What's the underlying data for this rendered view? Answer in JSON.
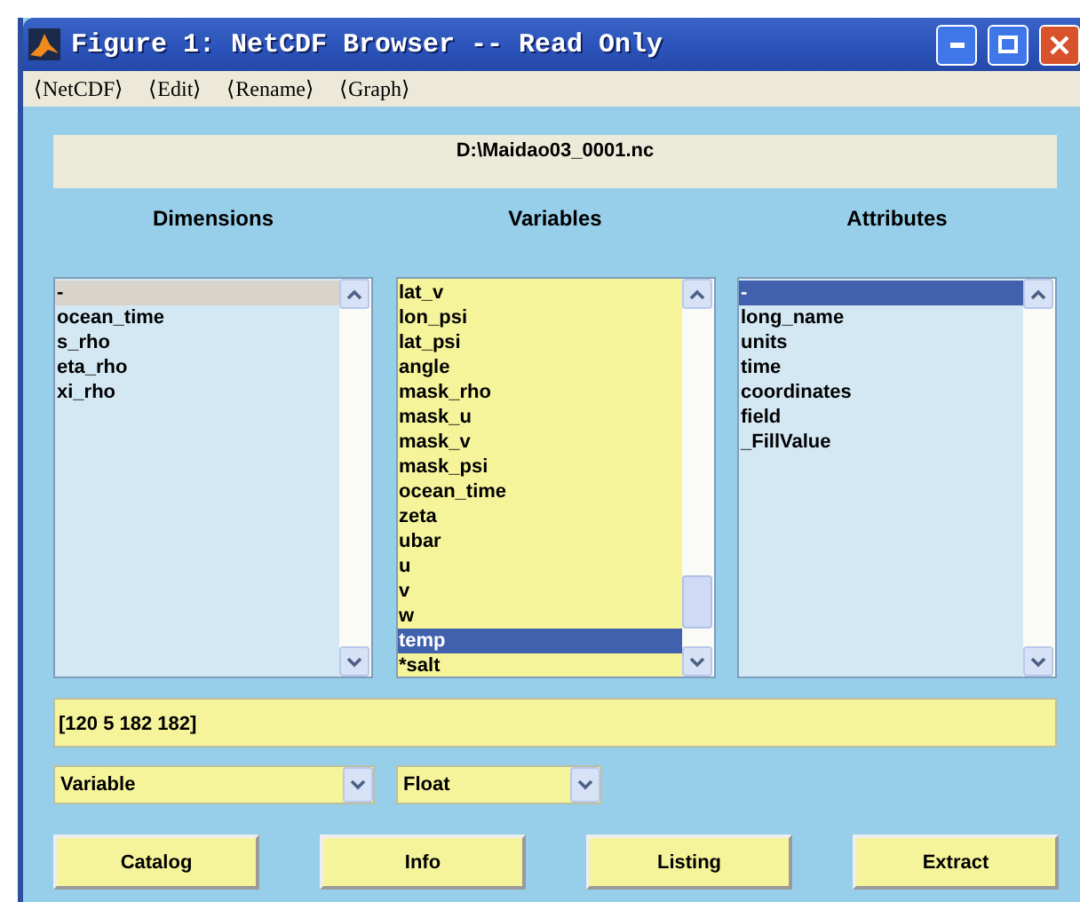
{
  "window": {
    "title": "Figure 1: NetCDF Browser -- Read Only"
  },
  "menu": [
    {
      "label": "⟨NetCDF⟩"
    },
    {
      "label": "⟨Edit⟩"
    },
    {
      "label": "⟨Rename⟩"
    },
    {
      "label": "⟨Graph⟩"
    }
  ],
  "file_path": "D:\\Maidao03_0001.nc",
  "lists": [
    {
      "heading": "Dimensions",
      "focused": false,
      "items": [
        {
          "label": "-",
          "selected": true
        },
        {
          "label": "ocean_time",
          "selected": false
        },
        {
          "label": "s_rho",
          "selected": false
        },
        {
          "label": "eta_rho",
          "selected": false
        },
        {
          "label": "xi_rho",
          "selected": false
        }
      ]
    },
    {
      "heading": "Variables",
      "focused": true,
      "items": [
        {
          "label": "lat_v",
          "selected": false
        },
        {
          "label": "lon_psi",
          "selected": false
        },
        {
          "label": "lat_psi",
          "selected": false
        },
        {
          "label": "angle",
          "selected": false
        },
        {
          "label": "mask_rho",
          "selected": false
        },
        {
          "label": "mask_u",
          "selected": false
        },
        {
          "label": "mask_v",
          "selected": false
        },
        {
          "label": "mask_psi",
          "selected": false
        },
        {
          "label": "ocean_time",
          "selected": false
        },
        {
          "label": "zeta",
          "selected": false
        },
        {
          "label": "ubar",
          "selected": false
        },
        {
          "label": "u",
          "selected": false
        },
        {
          "label": "v",
          "selected": false
        },
        {
          "label": "w",
          "selected": false
        },
        {
          "label": "temp",
          "selected": true
        },
        {
          "label": "*salt",
          "selected": false
        }
      ]
    },
    {
      "heading": "Attributes",
      "focused": true,
      "items": [
        {
          "label": "-",
          "selected": true
        },
        {
          "label": "long_name",
          "selected": false
        },
        {
          "label": "units",
          "selected": false
        },
        {
          "label": "time",
          "selected": false
        },
        {
          "label": "coordinates",
          "selected": false
        },
        {
          "label": "field",
          "selected": false
        },
        {
          "label": "_FillValue",
          "selected": false
        }
      ]
    }
  ],
  "shape_field": {
    "value": "[120 5 182 182]"
  },
  "dropdowns": [
    {
      "value": "Variable"
    },
    {
      "value": "Float"
    }
  ],
  "buttons": [
    "Catalog",
    "Info",
    "Listing",
    "Extract"
  ]
}
